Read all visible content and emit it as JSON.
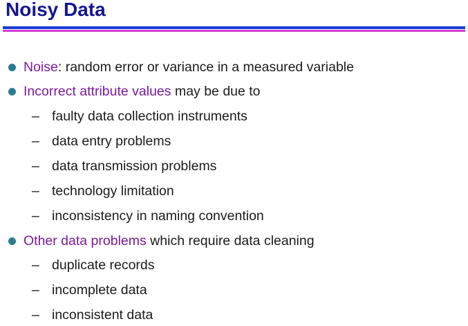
{
  "title": "Noisy Data",
  "bullets": [
    {
      "term": "Noise",
      "rest": ": random error or variance in a measured variable",
      "subitems": []
    },
    {
      "term": "Incorrect attribute values",
      "rest": " may be due to",
      "subitems": [
        "faulty data collection instruments",
        "data entry problems",
        "data transmission problems",
        "technology limitation",
        "inconsistency in naming convention"
      ]
    },
    {
      "term": "Other data problems",
      "rest": " which require data cleaning",
      "subitems": [
        "duplicate records",
        "incomplete data",
        "inconsistent data"
      ]
    }
  ],
  "sub_marker": "–",
  "colors": {
    "title": "#16168f",
    "rule_top": "#1a3bd6",
    "rule_bottom": "#d23ccf",
    "bullet": "#2c7c8f",
    "term": "#7b1a9a",
    "body_text": "#1a1a1a"
  }
}
